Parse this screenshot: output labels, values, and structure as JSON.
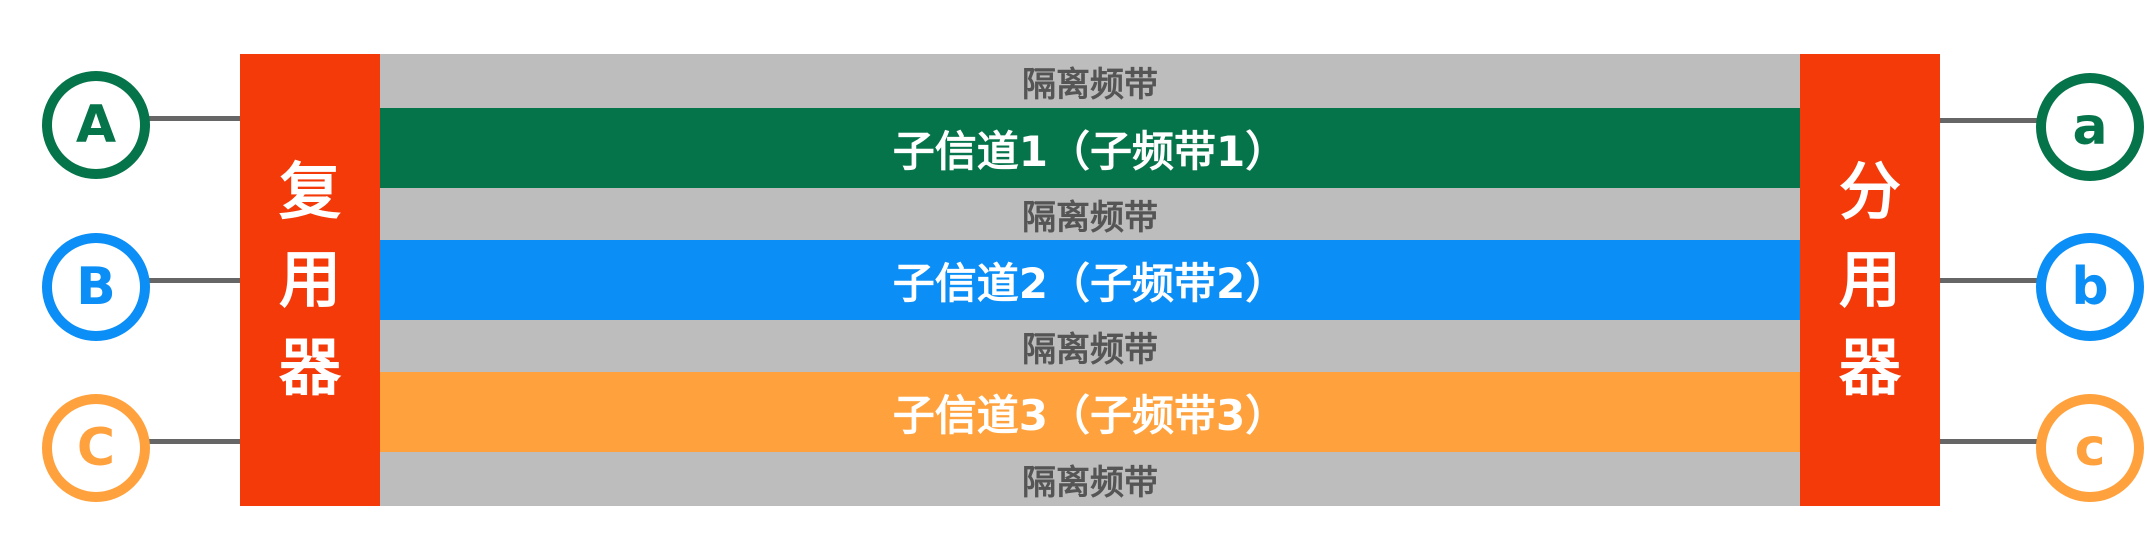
{
  "colors": {
    "box": "#f53a0a",
    "guard_band": "#bdbdbd",
    "channel_1": "#06744a",
    "channel_2": "#0b8ef6",
    "channel_3": "#ffa13c"
  },
  "multiplexer": {
    "chars": [
      "复",
      "用",
      "器"
    ]
  },
  "demultiplexer": {
    "chars": [
      "分",
      "用",
      "器"
    ]
  },
  "guard_bands": [
    "隔离频带",
    "隔离频带",
    "隔离频带",
    "隔离频带"
  ],
  "channels": [
    {
      "label": "子信道1（子频带1）",
      "color": "#06744a"
    },
    {
      "label": "子信道2（子频带2）",
      "color": "#0b8ef6"
    },
    {
      "label": "子信道3（子频带3）",
      "color": "#ffa13c"
    }
  ],
  "inputs": [
    {
      "letter": "A",
      "color": "#06744a"
    },
    {
      "letter": "B",
      "color": "#0b8ef6"
    },
    {
      "letter": "C",
      "color": "#ffa13c"
    }
  ],
  "outputs": [
    {
      "letter": "a",
      "color": "#06744a"
    },
    {
      "letter": "b",
      "color": "#0b8ef6"
    },
    {
      "letter": "c",
      "color": "#ffa13c"
    }
  ]
}
